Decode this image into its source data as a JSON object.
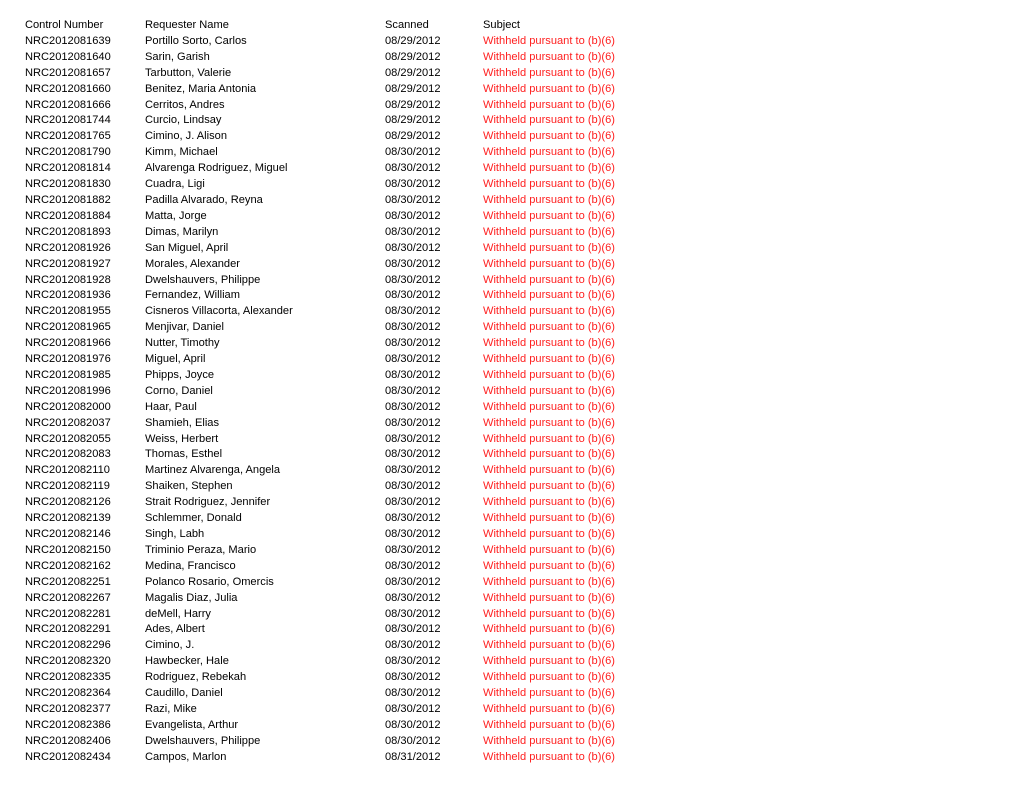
{
  "table": {
    "columns": [
      {
        "key": "control_number",
        "label": "Control Number"
      },
      {
        "key": "requester_name",
        "label": "Requester Name"
      },
      {
        "key": "scanned",
        "label": "Scanned"
      },
      {
        "key": "subject",
        "label": "Subject"
      }
    ],
    "redaction_color": "#ff2020",
    "rows": [
      {
        "control_number": "NRC2012081639",
        "requester_name": "Portillo Sorto, Carlos",
        "scanned": "08/29/2012",
        "subject": "Withheld pursuant to (b)(6)"
      },
      {
        "control_number": "NRC2012081640",
        "requester_name": "Sarin, Garish",
        "scanned": "08/29/2012",
        "subject": "Withheld pursuant to (b)(6)"
      },
      {
        "control_number": "NRC2012081657",
        "requester_name": "Tarbutton, Valerie",
        "scanned": "08/29/2012",
        "subject": "Withheld pursuant to (b)(6)"
      },
      {
        "control_number": "NRC2012081660",
        "requester_name": "Benitez, Maria Antonia",
        "scanned": "08/29/2012",
        "subject": "Withheld pursuant to (b)(6)"
      },
      {
        "control_number": "NRC2012081666",
        "requester_name": "Cerritos, Andres",
        "scanned": "08/29/2012",
        "subject": "Withheld pursuant to (b)(6)"
      },
      {
        "control_number": "NRC2012081744",
        "requester_name": "Curcio, Lindsay",
        "scanned": "08/29/2012",
        "subject": "Withheld pursuant to (b)(6)"
      },
      {
        "control_number": "NRC2012081765",
        "requester_name": "Cimino, J. Alison",
        "scanned": "08/29/2012",
        "subject": "Withheld pursuant to (b)(6)"
      },
      {
        "control_number": "NRC2012081790",
        "requester_name": "Kimm, Michael",
        "scanned": "08/30/2012",
        "subject": "Withheld pursuant to (b)(6)"
      },
      {
        "control_number": "NRC2012081814",
        "requester_name": "Alvarenga Rodriguez, Miguel",
        "scanned": "08/30/2012",
        "subject": "Withheld pursuant to (b)(6)"
      },
      {
        "control_number": "NRC2012081830",
        "requester_name": "Cuadra, Ligi",
        "scanned": "08/30/2012",
        "subject": "Withheld pursuant to (b)(6)"
      },
      {
        "control_number": "NRC2012081882",
        "requester_name": "Padilla Alvarado, Reyna",
        "scanned": "08/30/2012",
        "subject": "Withheld pursuant to (b)(6)"
      },
      {
        "control_number": "NRC2012081884",
        "requester_name": "Matta, Jorge",
        "scanned": "08/30/2012",
        "subject": "Withheld pursuant to (b)(6)"
      },
      {
        "control_number": "NRC2012081893",
        "requester_name": "Dimas, Marilyn",
        "scanned": "08/30/2012",
        "subject": "Withheld pursuant to (b)(6)"
      },
      {
        "control_number": "NRC2012081926",
        "requester_name": "San Miguel, April",
        "scanned": "08/30/2012",
        "subject": "Withheld pursuant to (b)(6)"
      },
      {
        "control_number": "NRC2012081927",
        "requester_name": "Morales, Alexander",
        "scanned": "08/30/2012",
        "subject": "Withheld pursuant to (b)(6)"
      },
      {
        "control_number": "NRC2012081928",
        "requester_name": "Dwelshauvers, Philippe",
        "scanned": "08/30/2012",
        "subject": "Withheld pursuant to (b)(6)"
      },
      {
        "control_number": "NRC2012081936",
        "requester_name": "Fernandez, William",
        "scanned": "08/30/2012",
        "subject": "Withheld pursuant to (b)(6)"
      },
      {
        "control_number": "NRC2012081955",
        "requester_name": "Cisneros Villacorta, Alexander",
        "scanned": "08/30/2012",
        "subject": "Withheld pursuant to (b)(6)"
      },
      {
        "control_number": "NRC2012081965",
        "requester_name": "Menjivar, Daniel",
        "scanned": "08/30/2012",
        "subject": "Withheld pursuant to (b)(6)"
      },
      {
        "control_number": "NRC2012081966",
        "requester_name": "Nutter, Timothy",
        "scanned": "08/30/2012",
        "subject": "Withheld pursuant to (b)(6)"
      },
      {
        "control_number": "NRC2012081976",
        "requester_name": "Miguel, April",
        "scanned": "08/30/2012",
        "subject": "Withheld pursuant to (b)(6)"
      },
      {
        "control_number": "NRC2012081985",
        "requester_name": "Phipps, Joyce",
        "scanned": "08/30/2012",
        "subject": "Withheld pursuant to (b)(6)"
      },
      {
        "control_number": "NRC2012081996",
        "requester_name": "Corno, Daniel",
        "scanned": "08/30/2012",
        "subject": "Withheld pursuant to (b)(6)"
      },
      {
        "control_number": "NRC2012082000",
        "requester_name": "Haar, Paul",
        "scanned": "08/30/2012",
        "subject": "Withheld pursuant to (b)(6)"
      },
      {
        "control_number": "NRC2012082037",
        "requester_name": "Shamieh, Elias",
        "scanned": "08/30/2012",
        "subject": "Withheld pursuant to (b)(6)"
      },
      {
        "control_number": "NRC2012082055",
        "requester_name": "Weiss, Herbert",
        "scanned": "08/30/2012",
        "subject": "Withheld pursuant to (b)(6)"
      },
      {
        "control_number": "NRC2012082083",
        "requester_name": "Thomas, Esthel",
        "scanned": "08/30/2012",
        "subject": "Withheld pursuant to (b)(6)"
      },
      {
        "control_number": "NRC2012082110",
        "requester_name": "Martinez Alvarenga, Angela",
        "scanned": "08/30/2012",
        "subject": "Withheld pursuant to (b)(6)"
      },
      {
        "control_number": "NRC2012082119",
        "requester_name": "Shaiken, Stephen",
        "scanned": "08/30/2012",
        "subject": "Withheld pursuant to (b)(6)"
      },
      {
        "control_number": "NRC2012082126",
        "requester_name": "Strait Rodriguez, Jennifer",
        "scanned": "08/30/2012",
        "subject": "Withheld pursuant to (b)(6)"
      },
      {
        "control_number": "NRC2012082139",
        "requester_name": "Schlemmer, Donald",
        "scanned": "08/30/2012",
        "subject": "Withheld pursuant to (b)(6)"
      },
      {
        "control_number": "NRC2012082146",
        "requester_name": "Singh, Labh",
        "scanned": "08/30/2012",
        "subject": "Withheld pursuant to (b)(6)"
      },
      {
        "control_number": "NRC2012082150",
        "requester_name": "Triminio Peraza, Mario",
        "scanned": "08/30/2012",
        "subject": "Withheld pursuant to (b)(6)"
      },
      {
        "control_number": "NRC2012082162",
        "requester_name": "Medina, Francisco",
        "scanned": "08/30/2012",
        "subject": "Withheld pursuant to (b)(6)"
      },
      {
        "control_number": "NRC2012082251",
        "requester_name": "Polanco Rosario, Omercis",
        "scanned": "08/30/2012",
        "subject": "Withheld pursuant to (b)(6)"
      },
      {
        "control_number": "NRC2012082267",
        "requester_name": "Magalis Diaz, Julia",
        "scanned": "08/30/2012",
        "subject": "Withheld pursuant to (b)(6)"
      },
      {
        "control_number": "NRC2012082281",
        "requester_name": "deMell, Harry",
        "scanned": "08/30/2012",
        "subject": "Withheld pursuant to (b)(6)"
      },
      {
        "control_number": "NRC2012082291",
        "requester_name": "Ades, Albert",
        "scanned": "08/30/2012",
        "subject": "Withheld pursuant to (b)(6)"
      },
      {
        "control_number": "NRC2012082296",
        "requester_name": "Cimino, J.",
        "scanned": "08/30/2012",
        "subject": "Withheld pursuant to (b)(6)"
      },
      {
        "control_number": "NRC2012082320",
        "requester_name": "Hawbecker, Hale",
        "scanned": "08/30/2012",
        "subject": "Withheld pursuant to (b)(6)"
      },
      {
        "control_number": "NRC2012082335",
        "requester_name": "Rodriguez, Rebekah",
        "scanned": "08/30/2012",
        "subject": "Withheld pursuant to (b)(6)"
      },
      {
        "control_number": "NRC2012082364",
        "requester_name": "Caudillo, Daniel",
        "scanned": "08/30/2012",
        "subject": "Withheld pursuant to (b)(6)"
      },
      {
        "control_number": "NRC2012082377",
        "requester_name": "Razi, Mike",
        "scanned": "08/30/2012",
        "subject": "Withheld pursuant to (b)(6)"
      },
      {
        "control_number": "NRC2012082386",
        "requester_name": "Evangelista, Arthur",
        "scanned": "08/30/2012",
        "subject": "Withheld pursuant to (b)(6)"
      },
      {
        "control_number": "NRC2012082406",
        "requester_name": "Dwelshauvers, Philippe",
        "scanned": "08/30/2012",
        "subject": "Withheld pursuant to (b)(6)"
      },
      {
        "control_number": "NRC2012082434",
        "requester_name": "Campos, Marlon",
        "scanned": "08/31/2012",
        "subject": "Withheld pursuant to (b)(6)"
      }
    ]
  }
}
